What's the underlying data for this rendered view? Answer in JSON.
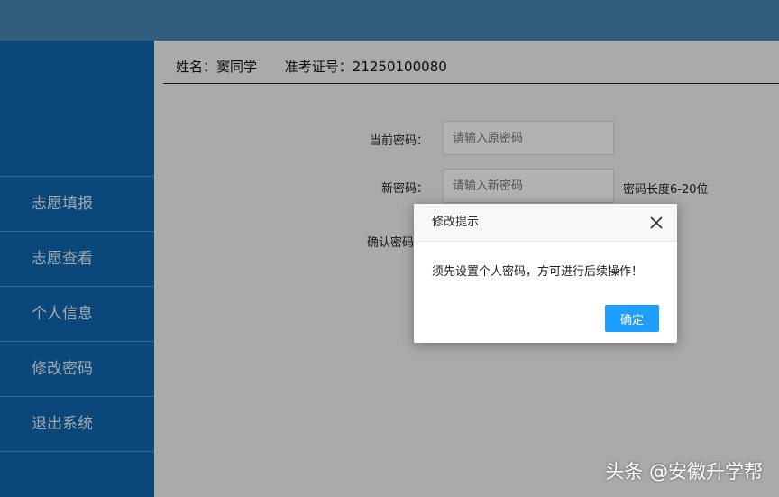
{
  "sidebar": {
    "items": [
      {
        "label": "志愿填报"
      },
      {
        "label": "志愿查看"
      },
      {
        "label": "个人信息"
      },
      {
        "label": "修改密码"
      },
      {
        "label": "退出系统"
      }
    ]
  },
  "userbar": {
    "name": "姓名：窦同学",
    "exam_id": "准考证号：21250100080"
  },
  "form": {
    "current_label": "当前密码：",
    "current_placeholder": "请输入原密码",
    "new_label": "新密码：",
    "new_placeholder": "请输入新密码",
    "new_hint": "密码长度6-20位",
    "confirm_label": "确认密码"
  },
  "dialog": {
    "title": "修改提示",
    "message": "须先设置个人密码，方可进行后续操作！",
    "ok_label": "确定"
  },
  "watermark": "头条 @安徽升学帮",
  "colors": {
    "topbar": "#4a86b4",
    "sidebar": "#0f68b2",
    "button": "#1e9fff"
  }
}
